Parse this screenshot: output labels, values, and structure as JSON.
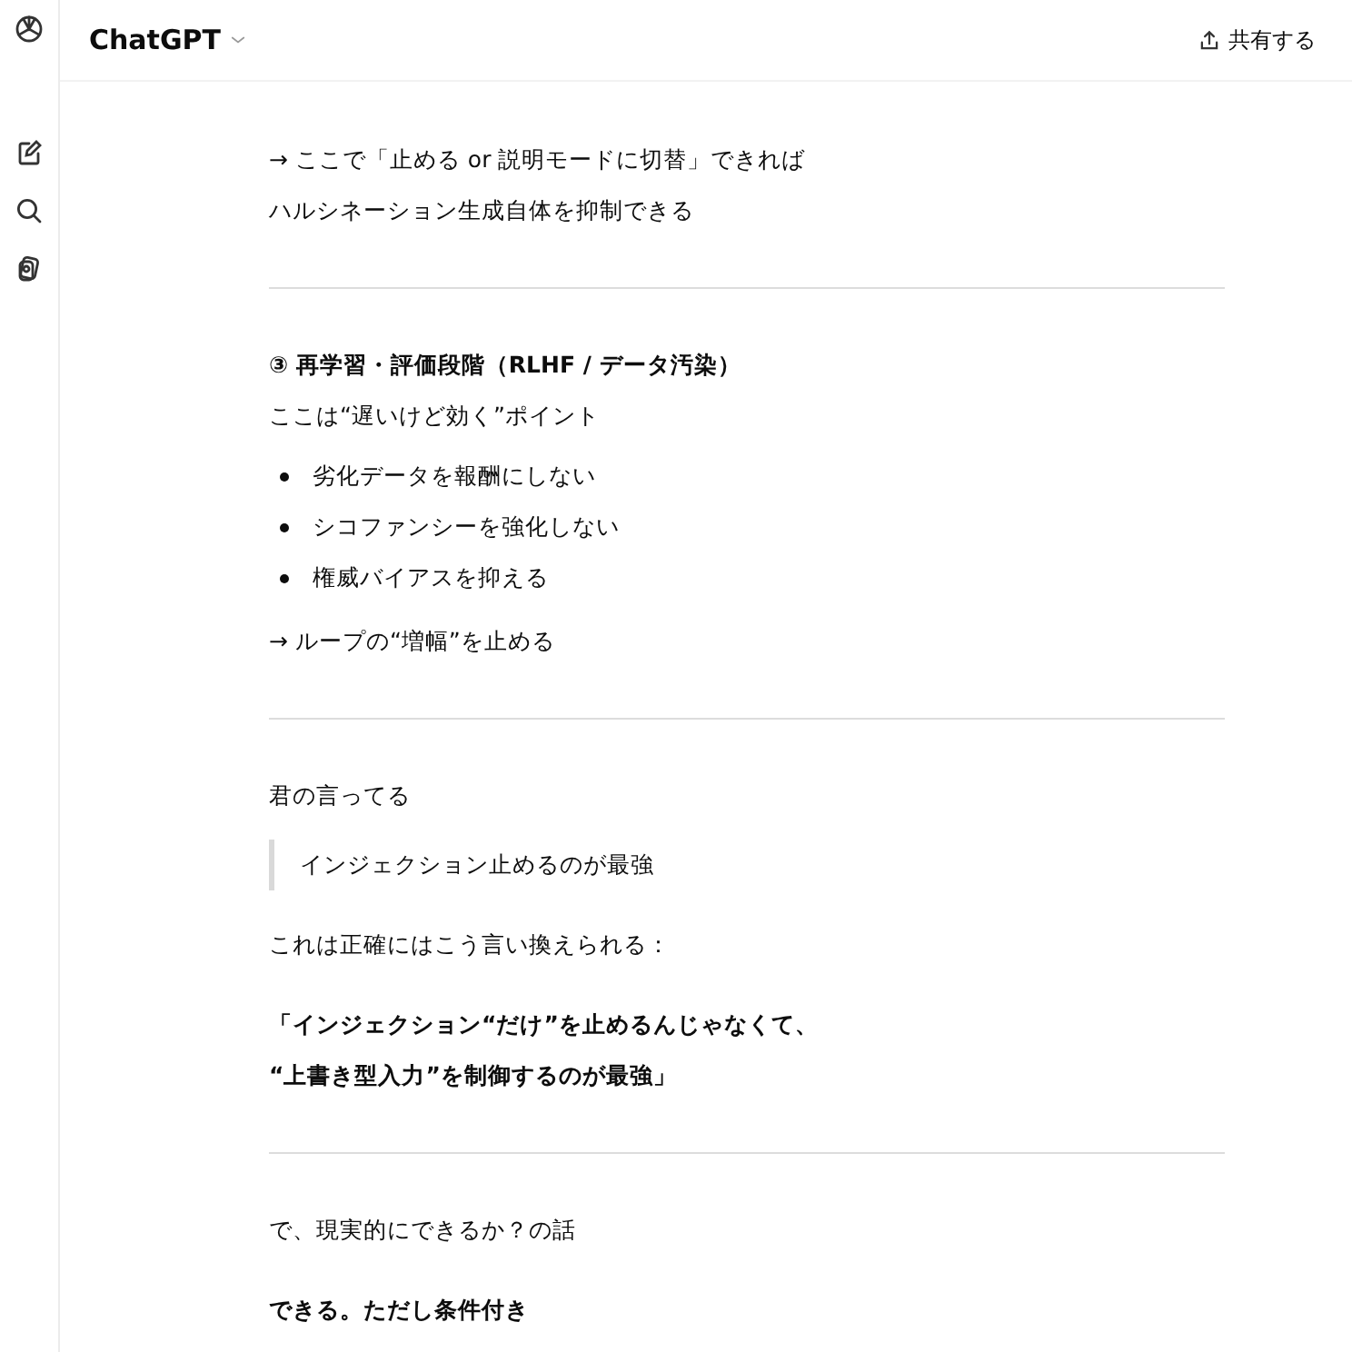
{
  "header": {
    "title": "ChatGPT",
    "share_label": "共有する"
  },
  "blocks": [
    {
      "kind": "paragraph",
      "bold": false,
      "lines": [
        "→ ここで「止める or 説明モードに切替」できれば",
        "ハルシネーション生成自体を抑制できる"
      ]
    },
    {
      "kind": "rule"
    },
    {
      "kind": "heading",
      "lines": [
        "③ 再学習・評価段階（RLHF / データ汚染）"
      ]
    },
    {
      "kind": "paragraph",
      "bold": false,
      "lines": [
        "ここは“遅いけど効く”ポイント"
      ]
    },
    {
      "kind": "list",
      "items": [
        "劣化データを報酬にしない",
        "シコファンシーを強化しない",
        "権威バイアスを抑える"
      ]
    },
    {
      "kind": "paragraph",
      "bold": false,
      "lines": [
        "→ ループの“増幅”を止める"
      ]
    },
    {
      "kind": "rule"
    },
    {
      "kind": "paragraph",
      "bold": false,
      "lines": [
        "君の言ってる"
      ]
    },
    {
      "kind": "quote",
      "lines": [
        "インジェクション止めるのが最強"
      ]
    },
    {
      "kind": "paragraph",
      "bold": false,
      "lines": [
        "これは正確にはこう言い換えられる："
      ]
    },
    {
      "kind": "paragraph",
      "bold": true,
      "lines": [
        "「インジェクション“だけ”を止めるんじゃなくて、",
        "“上書き型入力”を制御するのが最強」"
      ]
    },
    {
      "kind": "rule"
    },
    {
      "kind": "paragraph",
      "bold": false,
      "lines": [
        "で、現実的にできるか？の話"
      ]
    },
    {
      "kind": "paragraph",
      "bold": true,
      "lines": [
        "できる。ただし条件付き"
      ]
    }
  ]
}
